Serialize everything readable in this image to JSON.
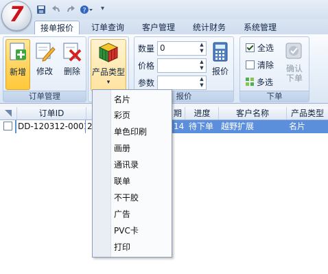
{
  "quick_access": {
    "icons": [
      "save-icon",
      "undo-icon",
      "redo-icon",
      "help-icon"
    ],
    "dropdown_glyph": "▾"
  },
  "tabs": [
    {
      "label": "接单报价",
      "active": true
    },
    {
      "label": "订单查询",
      "active": false
    },
    {
      "label": "客户管理",
      "active": false
    },
    {
      "label": "统计财务",
      "active": false
    },
    {
      "label": "系统管理",
      "active": false
    }
  ],
  "ribbon": {
    "order_group": {
      "label": "订单管理",
      "buttons": {
        "add": "新增",
        "edit": "修改",
        "delete": "删除"
      }
    },
    "product_group": {
      "button": "产品类型",
      "arrow": "▾"
    },
    "quote_group": {
      "label": "报价",
      "fields": {
        "quantity": {
          "label": "数量",
          "value": "0"
        },
        "price": {
          "label": "价格",
          "value": ""
        },
        "params": {
          "label": "参数",
          "value": ""
        }
      },
      "quote_button": "报价"
    },
    "order_place_group": {
      "label": "下单",
      "select_all": "全选",
      "clear": "清除",
      "multi_select": "多选",
      "confirm": "确认下单"
    }
  },
  "grid": {
    "columns": [
      "订单ID",
      "期",
      "进度",
      "客户名称",
      "产品类型"
    ],
    "rows": [
      {
        "checked": false,
        "order_id": "DD-120312-0001",
        "date_start": "20",
        "date_end": "14",
        "progress": "待下单",
        "customer": "越野扩展",
        "product": "名片"
      }
    ]
  },
  "product_menu": [
    "名片",
    "彩页",
    "单色印刷",
    "画册",
    "通讯录",
    "联单",
    "不干胶",
    "广告",
    "PVC卡",
    "打印"
  ],
  "colors": {
    "accent": "#5b8fdc",
    "ribbon": "#dbe6f4",
    "active_button": "#ffd45d"
  }
}
